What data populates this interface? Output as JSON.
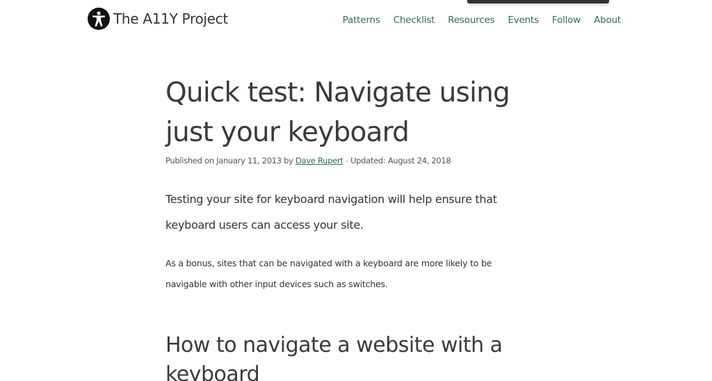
{
  "header": {
    "logo_text": "The A11Y Project",
    "nav": [
      "Patterns",
      "Checklist",
      "Resources",
      "Events",
      "Follow",
      "About"
    ]
  },
  "article": {
    "title": "Quick test: Navigate using just your keyboard",
    "meta": {
      "published_prefix": "Published on January 11, 2013 by ",
      "author": "Dave Rupert",
      "separator": " - ",
      "updated": "Updated: August 24, 2018"
    },
    "lead": "Testing your site for keyboard navigation will help ensure that keyboard users can access your site.",
    "paragraph": "As a bonus, sites that can be navigated with a keyboard are more likely to be navigable with other input devices such as switches.",
    "heading2": "How to navigate a website with a keyboard"
  },
  "colors": {
    "link": "#2a6f5f",
    "text": "#333333",
    "background": "#ffffff"
  },
  "icons": {
    "logo": "accessibility-person-icon"
  }
}
